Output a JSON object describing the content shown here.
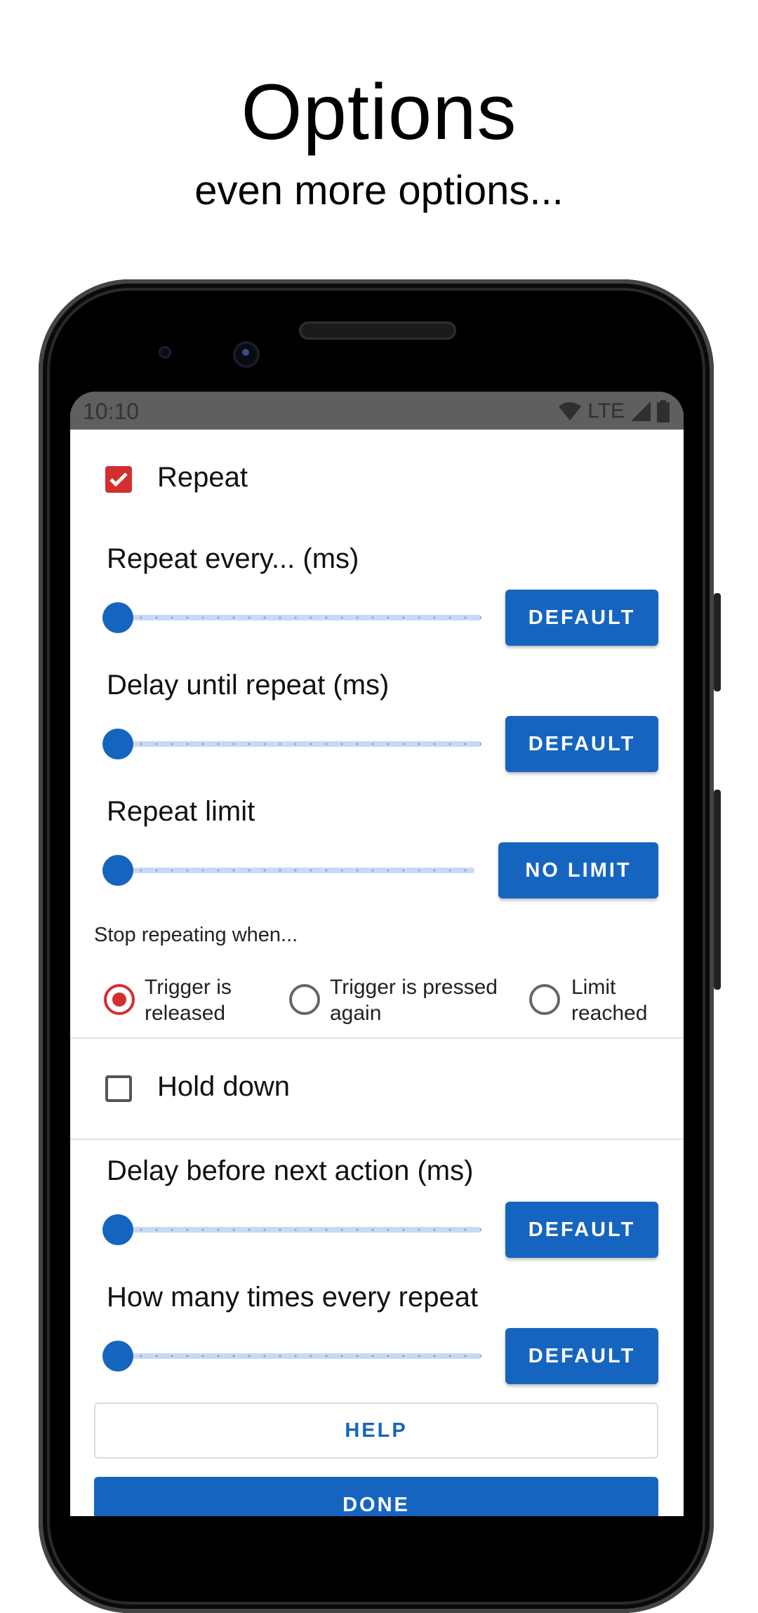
{
  "header": {
    "title": "Options",
    "subtitle": "even more options..."
  },
  "status_bar": {
    "time": "10:10",
    "network": "LTE",
    "icons": [
      "wifi-icon",
      "signal-icon",
      "battery-icon"
    ]
  },
  "repeat": {
    "label": "Repeat",
    "checked": true
  },
  "sliders": {
    "repeat_every": {
      "label": "Repeat every... (ms)",
      "button": "DEFAULT",
      "value_fraction": 0
    },
    "delay_until_repeat": {
      "label": "Delay until repeat (ms)",
      "button": "DEFAULT",
      "value_fraction": 0
    },
    "repeat_limit": {
      "label": "Repeat limit",
      "button": "NO LIMIT",
      "value_fraction": 0
    },
    "delay_before_next": {
      "label": "Delay before next action (ms)",
      "button": "DEFAULT",
      "value_fraction": 0
    },
    "times_every_repeat": {
      "label": "How many times every repeat",
      "button": "DEFAULT",
      "value_fraction": 0
    }
  },
  "stop_repeating": {
    "label": "Stop repeating when...",
    "options": [
      {
        "line1": "Trigger is",
        "line2": "released",
        "selected": true
      },
      {
        "line1": "Trigger is pressed",
        "line2": "again",
        "selected": false
      },
      {
        "line1": "Limit",
        "line2": "reached",
        "selected": false
      }
    ]
  },
  "hold_down": {
    "label": "Hold down",
    "checked": false
  },
  "actions": {
    "help": "HELP",
    "done": "DONE"
  },
  "colors": {
    "accent": "#1565c0",
    "checked": "#d32f2f"
  }
}
